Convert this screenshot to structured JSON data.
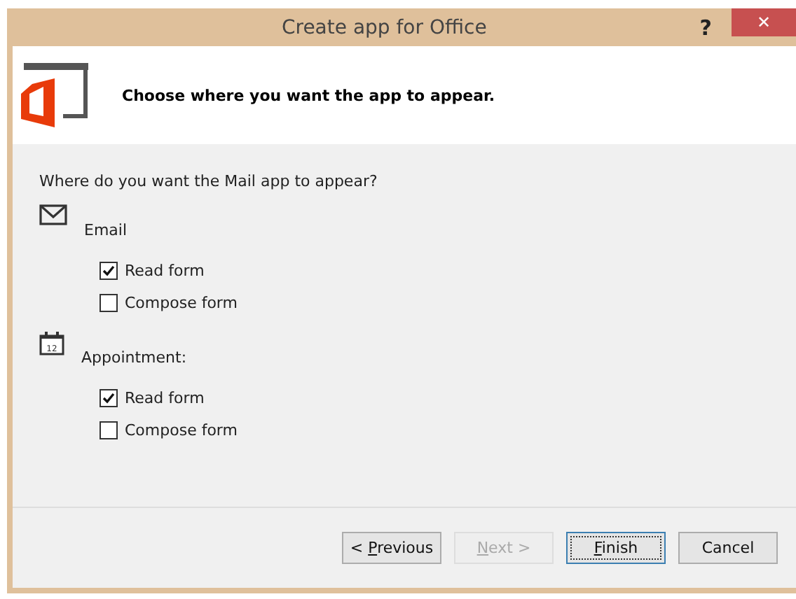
{
  "window": {
    "title": "Create app for Office",
    "help": "?",
    "close": "✕"
  },
  "header": {
    "text": "Choose where you want the app to appear."
  },
  "question": "Where do you want the Mail app to appear?",
  "groups": [
    {
      "kind": "mail",
      "label": "Email",
      "options": [
        {
          "label": "Read form",
          "checked": true
        },
        {
          "label": "Compose form",
          "checked": false
        }
      ]
    },
    {
      "kind": "calendar",
      "label": "Appointment:",
      "icon_text": "12",
      "options": [
        {
          "label": "Read form",
          "checked": true
        },
        {
          "label": "Compose form",
          "checked": false
        }
      ]
    }
  ],
  "buttons": [
    {
      "prefix": "< ",
      "key": "P",
      "suffix": "revious",
      "disabled": false,
      "default": false
    },
    {
      "key": "N",
      "suffix": "ext >",
      "disabled": true,
      "default": false
    },
    {
      "key": "F",
      "suffix": "inish",
      "disabled": false,
      "default": true
    },
    {
      "prefix": "Cancel",
      "disabled": false,
      "default": false
    }
  ]
}
